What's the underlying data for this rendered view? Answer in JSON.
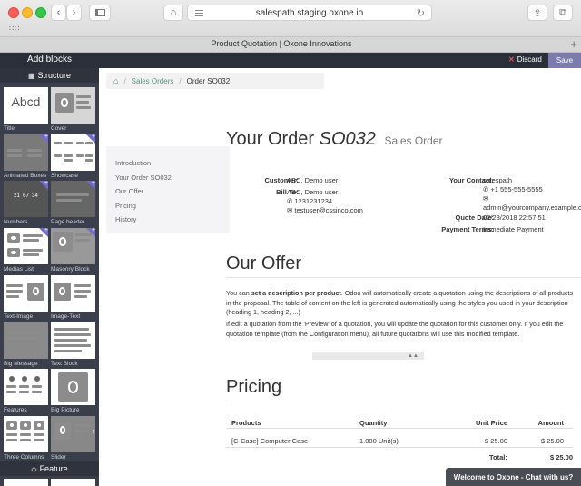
{
  "browser": {
    "url": "salespath.staging.oxone.io",
    "tab_title": "Product Quotation | Oxone Innovations",
    "plus": "+",
    "grid": "∷∷"
  },
  "editor": {
    "add_blocks": "Add blocks",
    "discard": "Discard",
    "save": "Save",
    "structure": "Structure",
    "feature": "Feature"
  },
  "blocks": [
    {
      "label": "Title",
      "kind": "title",
      "thumb_text": "Abcd",
      "new": false
    },
    {
      "label": "Cover",
      "kind": "cover",
      "new": false
    },
    {
      "label": "Animated Boxes",
      "kind": "boxes",
      "new": true
    },
    {
      "label": "Showcase",
      "kind": "showcase",
      "new": true
    },
    {
      "label": "Numbers",
      "kind": "numbers",
      "thumb_text": "21  67  34",
      "new": true
    },
    {
      "label": "Page header",
      "kind": "header",
      "new": true
    },
    {
      "label": "Medias List",
      "kind": "medias",
      "new": true
    },
    {
      "label": "Masonry Block",
      "kind": "masonry",
      "new": true
    },
    {
      "label": "Text-Image",
      "kind": "textimage",
      "new": false
    },
    {
      "label": "Image-Text",
      "kind": "imagetext",
      "new": false
    },
    {
      "label": "Big Message",
      "kind": "bigmsg",
      "new": false
    },
    {
      "label": "Text Block",
      "kind": "textblock",
      "new": false
    },
    {
      "label": "Features",
      "kind": "features",
      "new": false
    },
    {
      "label": "Big Picture",
      "kind": "bigpic",
      "new": false
    },
    {
      "label": "Three Columns",
      "kind": "threecol",
      "new": false
    },
    {
      "label": "Slider",
      "kind": "slider",
      "new": false
    }
  ],
  "breadcrumb": {
    "link": "Sales Orders",
    "current": "Order SO032"
  },
  "toc": [
    "Introduction",
    "Your Order SO032",
    "Our Offer",
    "Pricing",
    "History"
  ],
  "order": {
    "heading": "Your Order",
    "number": "SO032",
    "subtitle": "Sales Order",
    "customer_label": "Customer:",
    "customer": "ABC, Demo user",
    "billto_label": "Bill To:",
    "billto_name": "ABC, Demo user",
    "billto_phone": "1231231234",
    "billto_email": "testuser@cssinco.com",
    "contact_label": "Your Contact:",
    "contact_name": "salespath",
    "contact_phone": "+1 555-555-5555",
    "contact_email": "admin@yourcompany.example.com",
    "date_label": "Quote Date:",
    "date": "02/28/2018 22:57:51",
    "terms_label": "Payment Terms:",
    "terms": "Immediate Payment"
  },
  "offer": {
    "heading": "Our Offer",
    "p1_pre": "You can ",
    "p1_bold": "set a description per product",
    "p1_post": ". Odoo will automatically create a quotation using the descriptions of all products in the proposal. The table of content on the left is generated automatically using the styles you used in your description (heading 1, heading 2, ...)",
    "p2": "If edit a quotation from the 'Preview' of a quotation, you will update the quotation for this customer only. If you edit the quotation template (from the Configuration menu), all future quotations will use this modified template."
  },
  "pricing": {
    "heading": "Pricing",
    "headers": [
      "Products",
      "Quantity",
      "Unit Price",
      "Amount"
    ],
    "rows": [
      {
        "product": "[C-Case] Computer Case",
        "qty": "1.000 Unit(s)",
        "unit": "$ 25.00",
        "amount": "$ 25.00"
      }
    ],
    "total_label": "Total:",
    "total": "$ 25.00"
  },
  "chat": "Welcome to Oxone - Chat with us?"
}
